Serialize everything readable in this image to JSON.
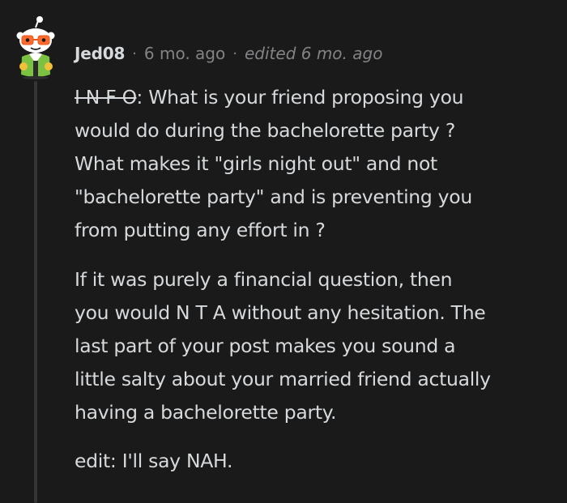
{
  "comment": {
    "username": "Jed08",
    "separator": "·",
    "time": "6 mo. ago",
    "edited": "edited 6 mo. ago",
    "avatar_icon": "snoo-avatar-icon",
    "paragraphs": {
      "p1_strike": "I N F O",
      "p1_line1_rest": ": What is your friend proposing you",
      "p1_line2": "would do during the bachelorette party ?",
      "p1_line3": "What makes it \"girls night out\" and not",
      "p1_line4": "\"bachelorette party\" and is preventing you",
      "p1_line5": "from putting any effort in ?",
      "p2_line1": "If it was purely a financial question, then",
      "p2_line2": "you would N T A without any hesitation. The",
      "p2_line3": "last part of your post makes you sound a",
      "p2_line4": "little salty about your married friend actually",
      "p2_line5": "having a bachelorette party.",
      "p3_line1": "edit: I'll say NAH."
    }
  },
  "colors": {
    "background": "#1a1a1b",
    "text": "#d7dadc",
    "meta": "#818384",
    "thread_line": "#343536"
  }
}
